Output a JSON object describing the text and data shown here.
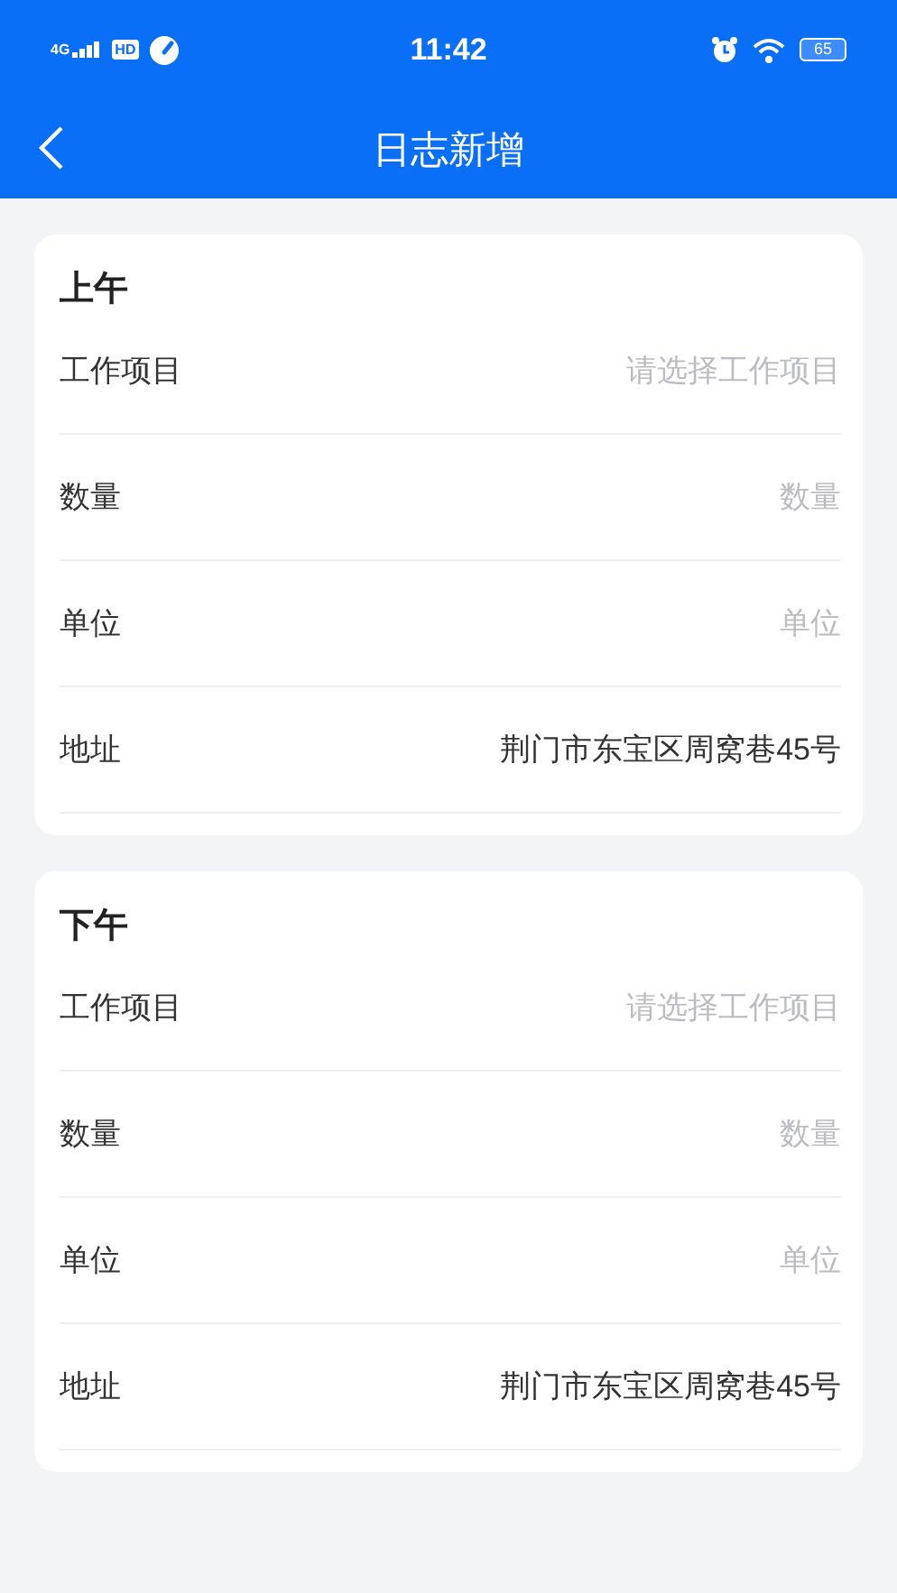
{
  "status_bar": {
    "network": "4G",
    "hd": "HD",
    "time": "11:42",
    "battery": "65"
  },
  "nav": {
    "title": "日志新增"
  },
  "sections": [
    {
      "title": "上午",
      "fields": [
        {
          "label": "工作项目",
          "placeholder": "请选择工作项目"
        },
        {
          "label": "数量",
          "placeholder": "数量"
        },
        {
          "label": "单位",
          "placeholder": "单位"
        },
        {
          "label": "地址",
          "value": "荆门市东宝区周窝巷45号"
        }
      ]
    },
    {
      "title": "下午",
      "fields": [
        {
          "label": "工作项目",
          "placeholder": "请选择工作项目"
        },
        {
          "label": "数量",
          "placeholder": "数量"
        },
        {
          "label": "单位",
          "placeholder": "单位"
        },
        {
          "label": "地址",
          "value": "荆门市东宝区周窝巷45号"
        }
      ]
    }
  ]
}
